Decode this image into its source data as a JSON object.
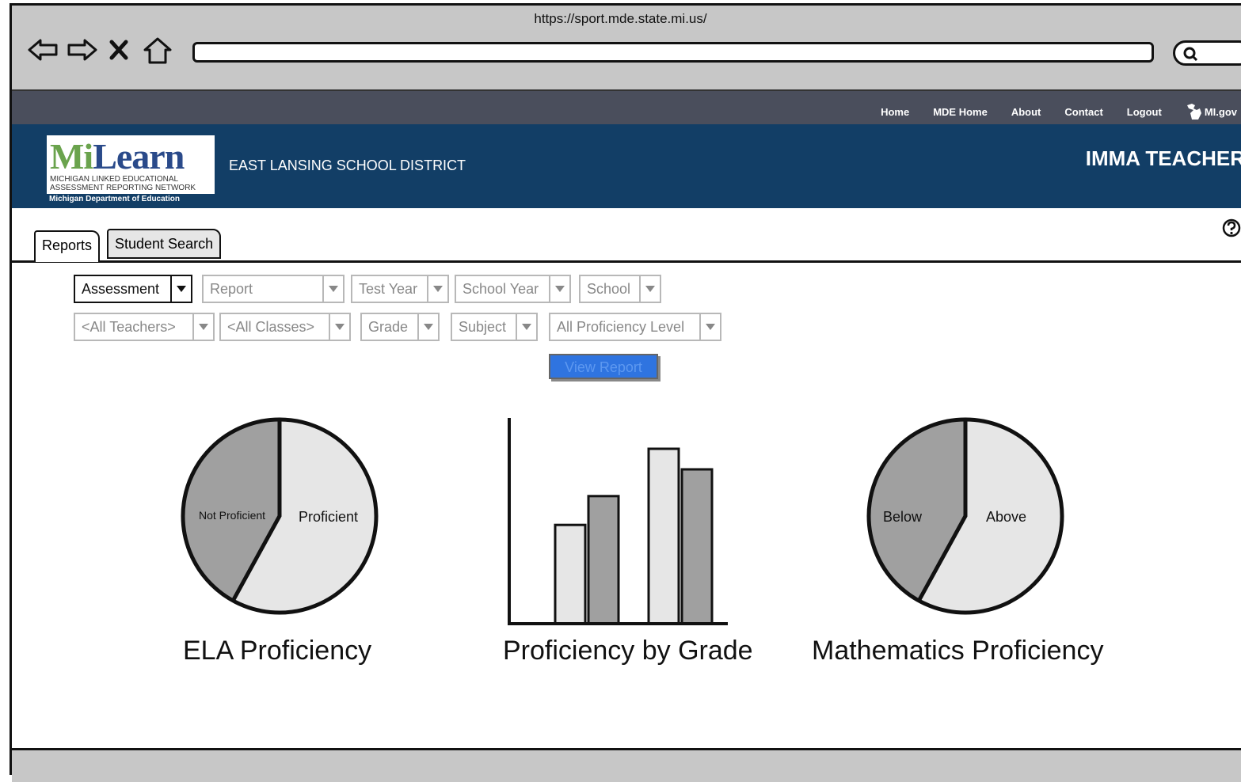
{
  "browser": {
    "url": "https://sport.mde.state.mi.us/"
  },
  "topnav": {
    "links": [
      "Home",
      "MDE Home",
      "About",
      "Contact",
      "Logout"
    ],
    "migov": "MI.gov"
  },
  "banner": {
    "logo": {
      "main_left": "Mi",
      "main_right": "Learn",
      "sub1": "MICHIGAN LINKED EDUCATIONAL",
      "sub2": "ASSESSMENT REPORTING NETWORK",
      "dept": "Michigan Department of Education"
    },
    "district": "EAST LANSING SCHOOL DISTRICT",
    "user": "IMMA TEACHER"
  },
  "tabs": [
    {
      "label": "Reports",
      "active": true
    },
    {
      "label": "Student Search",
      "active": false
    }
  ],
  "filters": {
    "row1": [
      "Assessment",
      "Report",
      "Test Year",
      "School Year",
      "School"
    ],
    "row2": [
      "<All Teachers>",
      "<All Classes>",
      "Grade",
      "Subject",
      "All Proficiency Level"
    ]
  },
  "view_report": "View Report",
  "chart_data": [
    {
      "type": "pie",
      "title": "ELA Proficiency",
      "labels": [
        "Not Proficient",
        "Proficient"
      ],
      "values": [
        42,
        58
      ]
    },
    {
      "type": "bar",
      "title": "Proficiency by Grade",
      "series": [
        {
          "values": [
            48,
            85
          ]
        },
        {
          "values": [
            62,
            75
          ]
        }
      ]
    },
    {
      "type": "pie",
      "title": "Mathematics Proficiency",
      "labels": [
        "Below",
        "Above"
      ],
      "values": [
        42,
        58
      ]
    }
  ],
  "colors": {
    "banner": "#123e66",
    "topnav": "#4a4e5c",
    "chrome": "#c7c7c7",
    "button": "#2f74e0",
    "pie_dark": "#a0a0a0",
    "pie_light": "#e6e6e6"
  }
}
